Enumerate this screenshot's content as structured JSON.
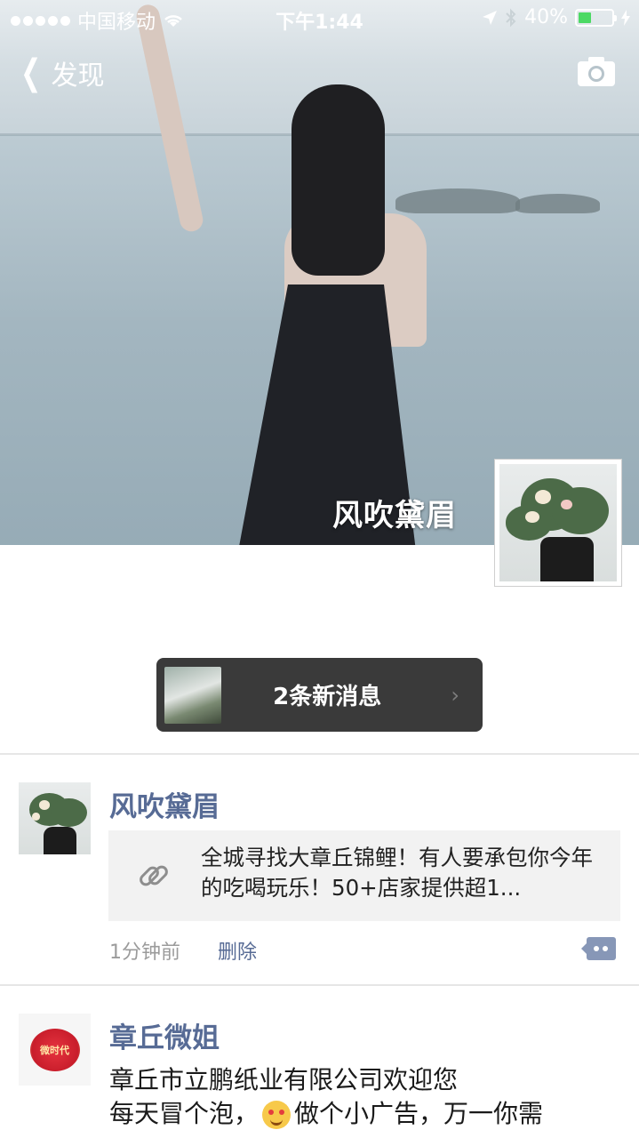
{
  "status_bar": {
    "carrier": "中国移动",
    "time": "下午1:44",
    "battery_percent": "40%",
    "battery_level": 0.4
  },
  "nav": {
    "back_label": "发现",
    "back_icon": "chevron-left-icon",
    "camera_icon": "camera-icon"
  },
  "cover": {
    "name": "风吹黛眉"
  },
  "new_messages": {
    "label": "2条新消息",
    "arrow": "›"
  },
  "posts": [
    {
      "author": "风吹黛眉",
      "link_title": "全城寻找大章丘锦鲤！有人要承包你今年的吃喝玩乐！50+店家提供超1...",
      "time": "1分钟前",
      "delete_label": "删除"
    },
    {
      "author": "章丘微姐",
      "avatar_text": "微时代",
      "text_line1": "章丘市立鹏纸业有限公司欢迎您",
      "text_line2a": "每天冒个泡，",
      "text_line2b": "做个小广告，万一你需"
    }
  ],
  "colors": {
    "link_blue": "#576b95",
    "new_msg_bg": "#3a3a3a",
    "battery_green": "#4cd964"
  }
}
